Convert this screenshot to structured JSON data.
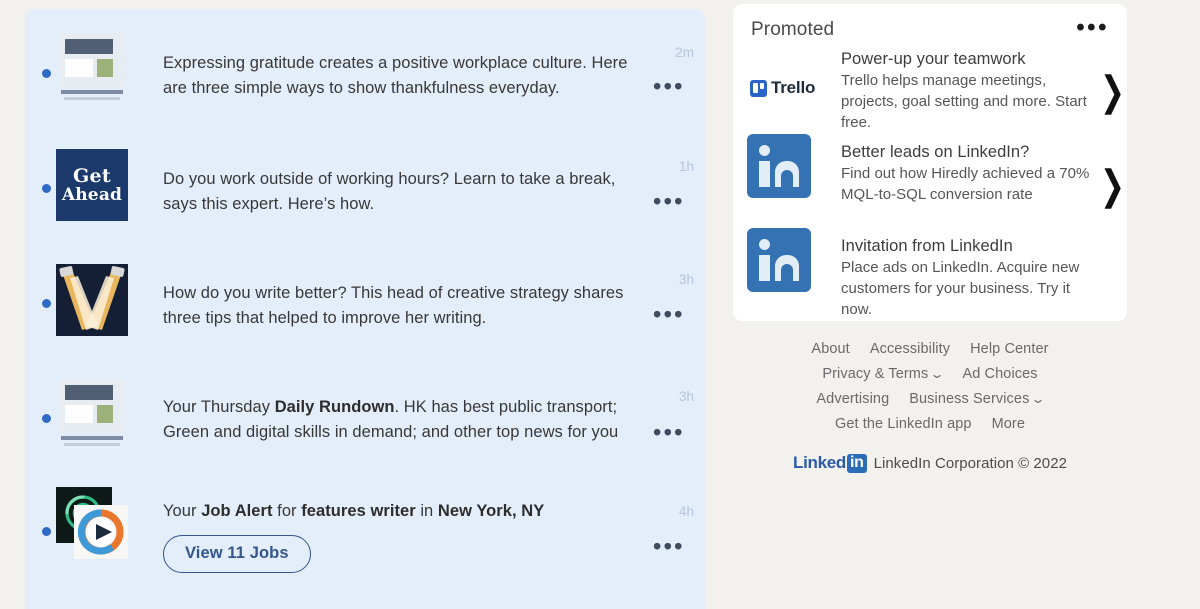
{
  "feed": {
    "items": [
      {
        "thumb": "newspaper-thumbnail",
        "text_parts": [
          {
            "t": "Expressing gratitude creates a positive workplace culture. Here are three simple ways to show thankfulness everyday.",
            "b": false
          }
        ],
        "time": "2m",
        "menu": "•••"
      },
      {
        "thumb": "get-ahead-thumbnail",
        "thumb_line1": "Get",
        "thumb_line2": "Ahead",
        "text_parts": [
          {
            "t": "Do you work outside of working hours? Learn to take a break, says this expert. Here’s how.",
            "b": false
          }
        ],
        "time": "1h",
        "menu": "•••"
      },
      {
        "thumb": "spotlight-thumbnail",
        "text_parts": [
          {
            "t": "How do you write better? This head of creative strategy shares three tips that helped to improve her writing.",
            "b": false
          }
        ],
        "time": "3h",
        "menu": "•••"
      },
      {
        "thumb": "newspaper-thumbnail",
        "text_parts": [
          {
            "t": "Your Thursday ",
            "b": false
          },
          {
            "t": "Daily Rundown",
            "b": true
          },
          {
            "t": ". HK has best public transport; Green and digital skills in demand; and other top news for you",
            "b": false
          }
        ],
        "time": "3h",
        "menu": "•••"
      },
      {
        "thumb": "job-video-thumbnail",
        "text_parts": [
          {
            "t": "Your ",
            "b": false
          },
          {
            "t": "Job Alert",
            "b": true
          },
          {
            "t": " for ",
            "b": false
          },
          {
            "t": "features writer",
            "b": true
          },
          {
            "t": " in ",
            "b": false
          },
          {
            "t": "New York, NY",
            "b": true
          }
        ],
        "button_label": "View 11 Jobs",
        "time": "4h",
        "menu": "•••"
      }
    ]
  },
  "promoted": {
    "title": "Promoted",
    "menu": "•••",
    "chevron": "❯",
    "items": [
      {
        "logo": "trello-logo",
        "logo_word": "Trello",
        "title": "Power-up your teamwork",
        "sub": "Trello helps manage meetings, projects, goal setting and more. Start free."
      },
      {
        "logo": "linkedin-logo",
        "title": "Better leads on LinkedIn?",
        "sub": "Find out how Hiredly achieved a 70% MQL-to-SQL conversion rate"
      },
      {
        "logo": "linkedin-logo",
        "title": "Invitation from LinkedIn",
        "sub": "Place ads on LinkedIn. Acquire new customers for your business. Try it now."
      }
    ]
  },
  "footer": {
    "rows": [
      [
        {
          "label": "About",
          "chevron": false
        },
        {
          "label": "Accessibility",
          "chevron": false
        },
        {
          "label": "Help Center",
          "chevron": false
        }
      ],
      [
        {
          "label": "Privacy & Terms",
          "chevron": true
        },
        {
          "label": "Ad Choices",
          "chevron": false
        }
      ],
      [
        {
          "label": "Advertising",
          "chevron": false
        },
        {
          "label": "Business Services",
          "chevron": true
        }
      ],
      [
        {
          "label": "Get the LinkedIn app",
          "chevron": false
        },
        {
          "label": "More",
          "chevron": false
        }
      ]
    ],
    "wordmark_text": "Linked",
    "wordmark_badge": "in",
    "copyright": "LinkedIn Corporation © 2022"
  },
  "colors": {
    "page_bg": "#f2f1ed",
    "feed_bg": "#e4edfa",
    "accent_blue": "#2f6ac4",
    "linkedin_blue": "#3472b4",
    "card_bg": "#ffffff"
  }
}
